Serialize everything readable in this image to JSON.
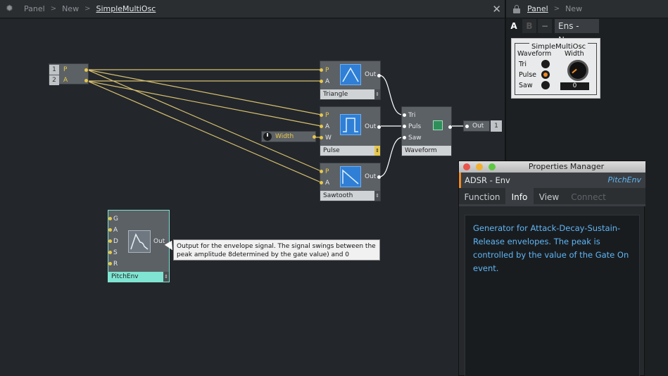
{
  "colors": {
    "accent": "#f08a24",
    "wire_yellow": "#e8c84a",
    "link_blue": "#5fb6f5",
    "module_icon": "#2f7fd6",
    "env_teal": "#7fe5d2"
  },
  "editor": {
    "breadcrumb": [
      "Panel",
      "New",
      "SimpleMultiOsc"
    ],
    "inputs": [
      {
        "num": "1",
        "name": "P"
      },
      {
        "num": "2",
        "name": "A"
      }
    ],
    "modules": {
      "triangle": {
        "label": "Triangle",
        "ports": [
          "P",
          "A"
        ],
        "out": "Out"
      },
      "pulse": {
        "label": "Pulse",
        "ports": [
          "P",
          "A",
          "W"
        ],
        "out": "Out"
      },
      "sawtooth": {
        "label": "Sawtooth",
        "ports": [
          "P",
          "A"
        ],
        "out": "Out"
      },
      "waveform": {
        "label": "Waveform",
        "ports": [
          "Tri",
          "Puls",
          "Saw"
        ]
      },
      "pitchenv": {
        "label": "PitchEnv",
        "ports": [
          "G",
          "A",
          "D",
          "S",
          "R"
        ],
        "out": "Out"
      }
    },
    "width_ctrl": {
      "label": "Width"
    },
    "out_module": {
      "label": "Out",
      "channel": "1"
    },
    "tooltip": "Output for the envelope signal. The signal swings between the peak amplitude 8determined by the gate value) and 0"
  },
  "panel": {
    "breadcrumb": [
      "Panel",
      "New"
    ],
    "tabs": [
      "A",
      "B",
      "−"
    ],
    "ensemble": "Ens - New",
    "instrument": {
      "title": "SimpleMultiOsc",
      "waveform_label": "Waveform",
      "width_label": "Width",
      "options": [
        "Tri",
        "Pulse",
        "Saw"
      ],
      "selected": "Pulse",
      "width_value": "0"
    }
  },
  "properties": {
    "title": "Properties Manager",
    "module": "ADSR - Env",
    "instance": "PitchEnv",
    "tabs": [
      "Function",
      "Info",
      "View",
      "Connect"
    ],
    "active_tab": "Info",
    "info": "Generator for Attack-Decay-Sustain-Release envelopes. The peak is controlled by the value of the Gate On event."
  }
}
